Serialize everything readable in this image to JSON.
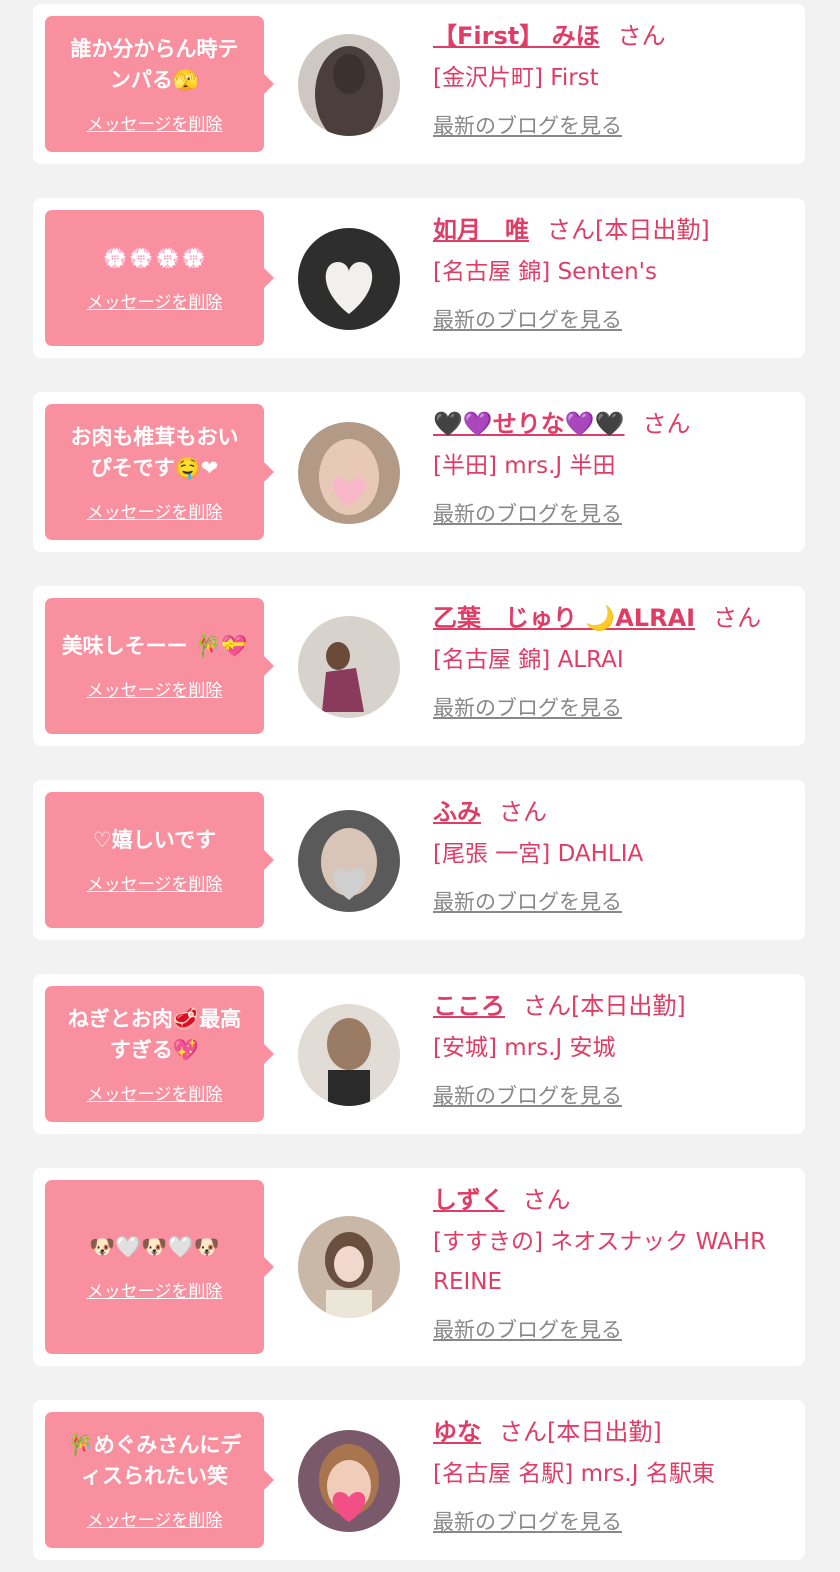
{
  "colors": {
    "page_bg": "#f2f2f2",
    "card_bg": "#ffffff",
    "bubble_bg": "#f9909f",
    "name_pink": "#e03d66",
    "link_gray": "#888888"
  },
  "labels": {
    "delete": "メッセージを削除",
    "blog": "最新のブログを見る"
  },
  "items": [
    {
      "message": "誰か分からん時テ\nンパる🫣",
      "name": "【First】 みほ",
      "suffix": "さん",
      "shop": "[金沢片町] First",
      "avatar_icon": "avatar-photo-icon"
    },
    {
      "message": "💮💮💮💮",
      "name": "如月　唯",
      "suffix": "さん[本日出勤]",
      "shop": "[名古屋 錦] Senten's",
      "avatar_icon": "avatar-photo-icon"
    },
    {
      "message": "お肉も椎茸もおい\nぴそです🤤❤",
      "name": "🖤💜せりな💜🖤",
      "suffix": "さん",
      "shop": "[半田] mrs.J 半田",
      "avatar_icon": "avatar-photo-icon"
    },
    {
      "message": "美味しそーー 🎋💝",
      "name": "乙葉　じゅり 🌙ALRAI",
      "suffix": "さん",
      "shop": "[名古屋 錦] ALRAI",
      "avatar_icon": "avatar-photo-icon"
    },
    {
      "message": "♡嬉しいです",
      "name": "ふみ",
      "suffix": "さん",
      "shop": "[尾張 一宮] DAHLIA",
      "avatar_icon": "avatar-photo-icon"
    },
    {
      "message": "ねぎとお肉🥩最高\nすぎる💖",
      "name": "こころ",
      "suffix": "さん[本日出勤]",
      "shop": "[安城] mrs.J 安城",
      "avatar_icon": "avatar-photo-icon"
    },
    {
      "message": "🐶🤍🐶🤍🐶",
      "name": "しずく",
      "suffix": "さん",
      "shop": "[すすきの] ネオスナック WAHR REINE",
      "avatar_icon": "avatar-photo-icon"
    },
    {
      "message": "🎋めぐみさんにデ\nィスられたい笑",
      "name": "ゆな",
      "suffix": "さん[本日出勤]",
      "shop": "[名古屋 名駅] mrs.J 名駅東",
      "avatar_icon": "avatar-photo-icon"
    }
  ]
}
